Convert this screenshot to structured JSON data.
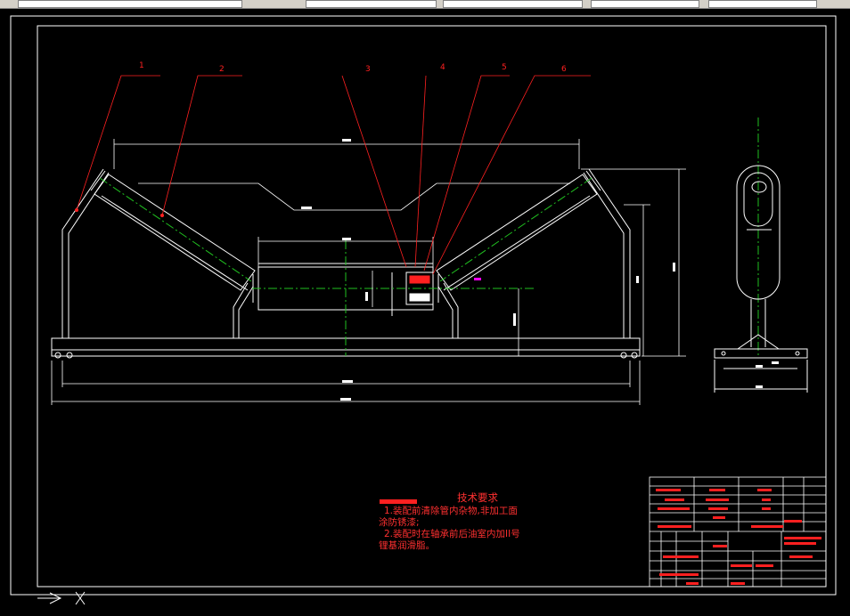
{
  "colors": {
    "background": "#000000",
    "frame": "#ffffff",
    "leader": "#ff2020",
    "centerline": "#20c020",
    "notes": "#ff3030",
    "annotation": "#ff00ff"
  },
  "part_numbers": [
    "1",
    "2",
    "3",
    "4",
    "5",
    "6"
  ],
  "tech_requirements": {
    "title": "技术要求",
    "lines": [
      "1.装配前清除管内杂物,非加工面",
      "涂防锈漆;",
      "2.装配时在轴承前后油室内加II号",
      "锂基润滑脂。"
    ]
  }
}
